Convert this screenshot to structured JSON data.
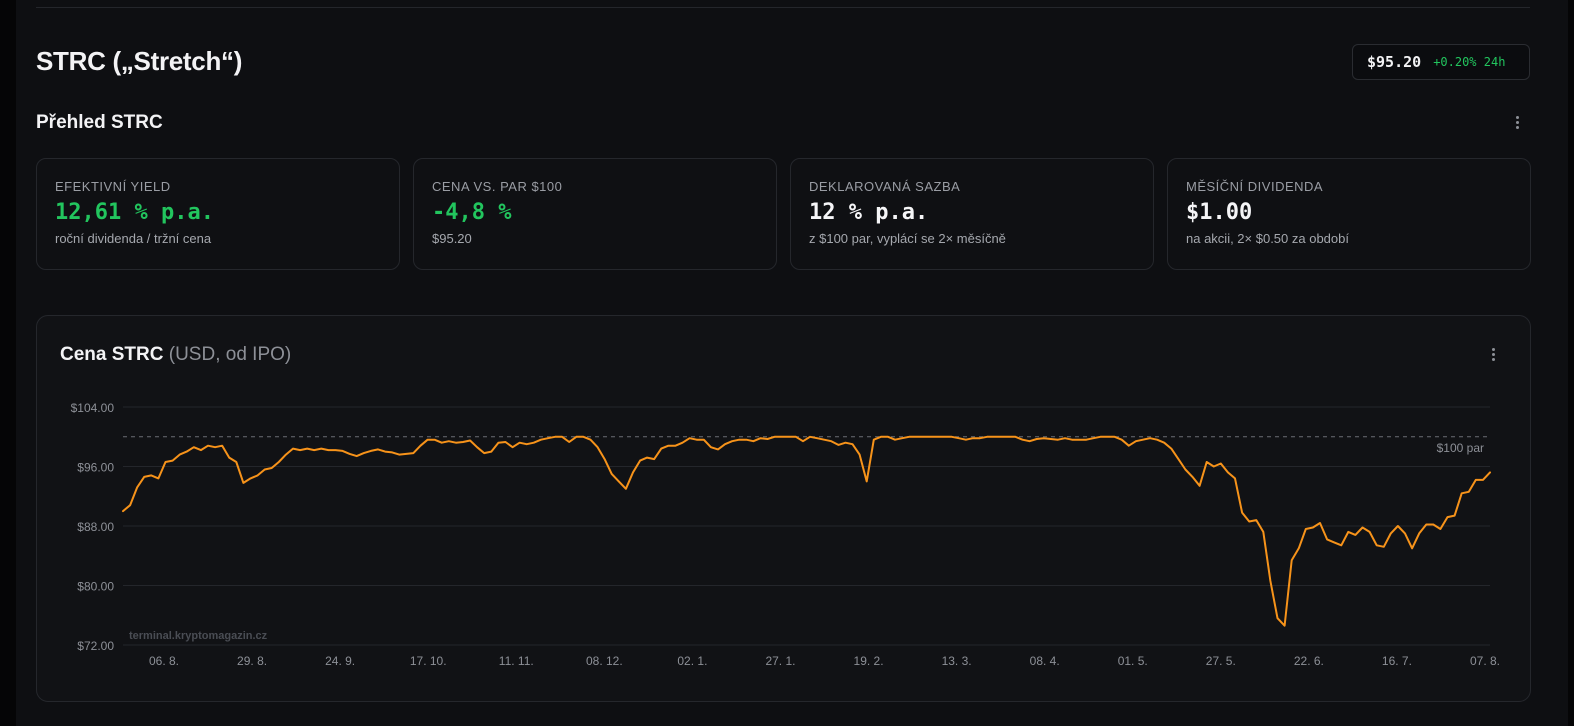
{
  "header": {
    "title": "STRC („Stretch“)",
    "price": "$95.20",
    "change": "+0.20% 24h"
  },
  "overview": {
    "title": "Přehled STRC",
    "cards": [
      {
        "label": "EFEKTIVNÍ YIELD",
        "value": "12,61 % p.a.",
        "sub": "roční dividenda / tržní cena"
      },
      {
        "label": "CENA VS. PAR $100",
        "value": "-4,8 %",
        "sub": "$95.20"
      },
      {
        "label": "DEKLAROVANÁ SAZBA",
        "value": "12 % p.a.",
        "sub": "z $100 par, vyplácí se 2× měsíčně"
      },
      {
        "label": "MĚSÍČNÍ DIVIDENDA",
        "value": "$1.00",
        "sub": "na akcii, 2× $0.50 za období"
      }
    ]
  },
  "colors": {
    "accent": "#f7931a",
    "positive": "#22c55e"
  },
  "chart": {
    "title": "Cena STRC",
    "subtitle": "(USD, od IPO)",
    "par_label": "$100 par",
    "watermark": "terminal.kryptomagazin.cz"
  },
  "chart_data": {
    "type": "line",
    "title": "Cena STRC (USD, od IPO)",
    "xlabel": "",
    "ylabel": "",
    "ylim": [
      72,
      104
    ],
    "yticks": [
      104,
      96,
      88,
      80,
      72
    ],
    "ytick_labels": [
      "$104.00",
      "$96.00",
      "$88.00",
      "$80.00",
      "$72.00"
    ],
    "x_ticks": [
      "06. 8.",
      "29. 8.",
      "24. 9.",
      "17. 10.",
      "11. 11.",
      "08. 12.",
      "02. 1.",
      "27. 1.",
      "19. 2.",
      "13. 3.",
      "08. 4.",
      "01. 5.",
      "27. 5.",
      "22. 6.",
      "16. 7.",
      "07. 8."
    ],
    "grid": true,
    "reference_line": {
      "value": 100,
      "label": "$100 par"
    },
    "series": [
      {
        "color": "#f7931a",
        "values": [
          90.0,
          90.8,
          93.2,
          94.6,
          94.8,
          94.4,
          96.6,
          96.8,
          97.6,
          98.0,
          98.6,
          98.2,
          98.8,
          98.6,
          98.8,
          97.2,
          96.6,
          93.8,
          94.4,
          94.8,
          95.6,
          95.8,
          96.6,
          97.6,
          98.4,
          98.2,
          98.4,
          98.2,
          98.4,
          98.2,
          98.2,
          98.1,
          97.7,
          97.4,
          97.8,
          98.1,
          98.3,
          98.0,
          97.9,
          97.6,
          97.7,
          97.8,
          98.8,
          99.6,
          99.6,
          99.2,
          99.4,
          99.2,
          99.3,
          99.5,
          98.6,
          97.8,
          98.0,
          99.2,
          99.3,
          98.6,
          99.2,
          99.0,
          99.2,
          99.6,
          99.8,
          100.0,
          100.0,
          99.3,
          100.0,
          100.0,
          99.6,
          98.6,
          97.0,
          95.0,
          94.0,
          93.0,
          95.2,
          96.8,
          97.2,
          97.0,
          98.4,
          98.8,
          98.8,
          99.2,
          99.8,
          99.6,
          99.6,
          98.6,
          98.3,
          99.0,
          99.4,
          99.6,
          99.6,
          99.4,
          99.8,
          99.7,
          100.0,
          100.0,
          100.0,
          100.0,
          99.4,
          100.0,
          99.8,
          99.6,
          99.4,
          98.9,
          99.2,
          99.0,
          97.6,
          94.0,
          99.6,
          100.0,
          100.0,
          99.6,
          99.8,
          100.0,
          100.0,
          100.0,
          100.0,
          100.0,
          100.0,
          100.0,
          99.8,
          99.6,
          99.8,
          99.8,
          100.0,
          100.0,
          100.0,
          100.0,
          100.0,
          99.6,
          99.4,
          99.7,
          99.8,
          99.7,
          99.6,
          99.8,
          99.6,
          99.6,
          99.6,
          99.8,
          100.0,
          100.0,
          100.0,
          99.6,
          98.8,
          99.4,
          99.6,
          99.8,
          99.6,
          99.2,
          98.4,
          97.0,
          95.6,
          94.6,
          93.4,
          96.6,
          96.0,
          96.4,
          95.2,
          94.4,
          89.8,
          88.6,
          88.8,
          87.2,
          80.6,
          75.6,
          74.6,
          83.4,
          85.0,
          87.6,
          87.8,
          88.4,
          86.2,
          85.8,
          85.4,
          87.2,
          86.8,
          87.8,
          87.2,
          85.4,
          85.2,
          87.0,
          88.0,
          87.0,
          85.0,
          87.0,
          88.2,
          88.2,
          87.6,
          89.2,
          89.4,
          92.4,
          92.6,
          94.2,
          94.2,
          95.2
        ]
      }
    ]
  }
}
